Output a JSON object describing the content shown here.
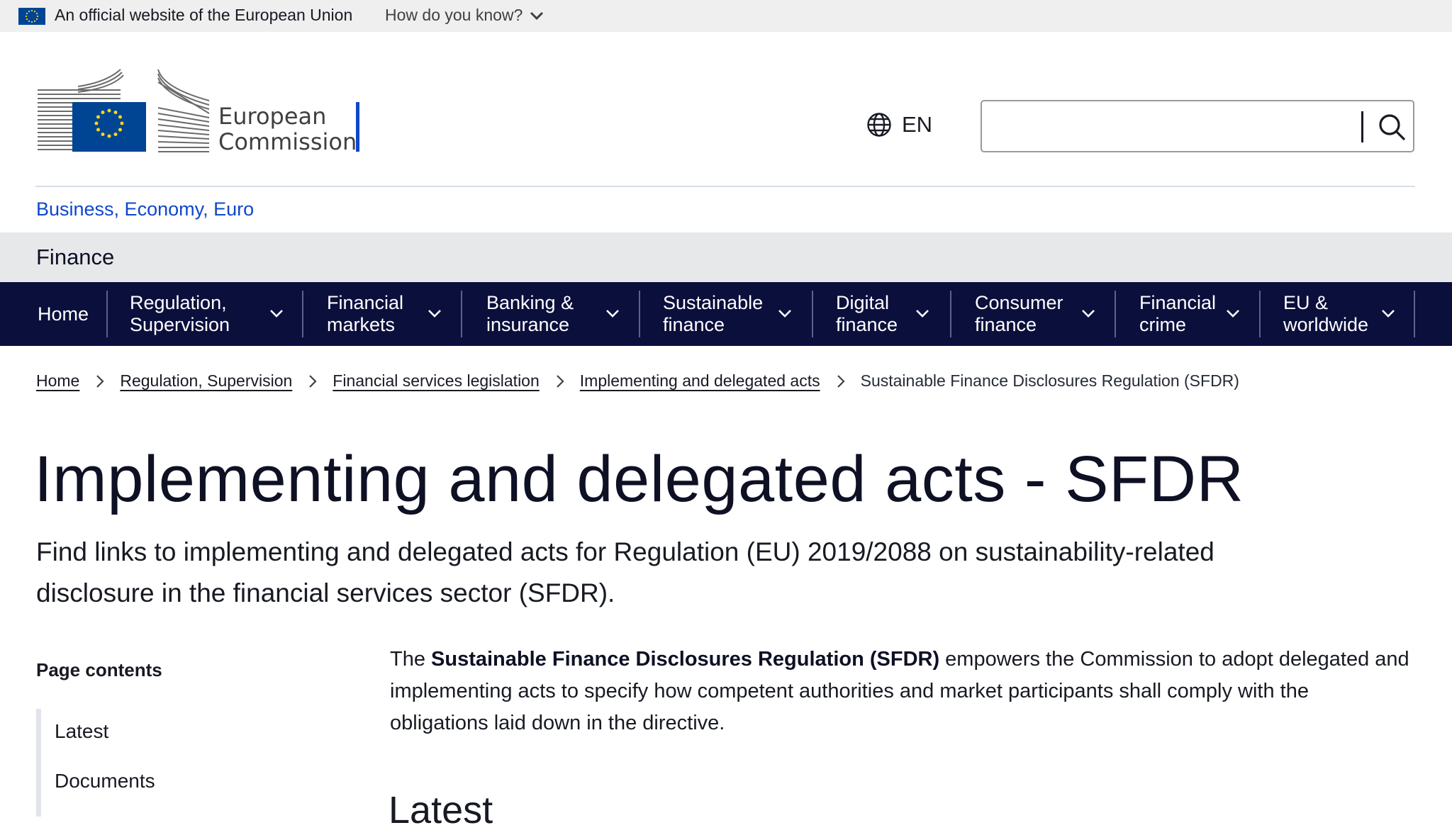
{
  "eu_bar": {
    "official_text": "An official website of the European Union",
    "how_label": "How do you know?"
  },
  "logo": {
    "line1": "European",
    "line2": "Commission"
  },
  "language": {
    "code": "EN"
  },
  "search": {
    "placeholder": "",
    "value": ""
  },
  "site_name": "Business, Economy, Euro",
  "section_title": "Finance",
  "nav": {
    "home": "Home",
    "items": [
      {
        "line1": "Regulation,",
        "line2": "Supervision"
      },
      {
        "line1": "Financial",
        "line2": "markets"
      },
      {
        "line1": "Banking &",
        "line2": "insurance"
      },
      {
        "line1": "Sustainable",
        "line2": "finance"
      },
      {
        "line1": "Digital",
        "line2": "finance"
      },
      {
        "line1": "Consumer",
        "line2": "finance"
      },
      {
        "line1": "Financial",
        "line2": "crime"
      },
      {
        "line1": "EU &",
        "line2": "worldwide"
      }
    ]
  },
  "breadcrumb": {
    "items": [
      "Home",
      "Regulation, Supervision",
      "Financial services legislation",
      "Implementing and delegated acts"
    ],
    "current": "Sustainable Finance Disclosures Regulation (SFDR)"
  },
  "page": {
    "title": "Implementing and delegated acts - SFDR",
    "intro": "Find links to implementing and delegated acts for Regulation (EU) 2019/2088 on sustainability-related disclosure in the financial services sector (SFDR)."
  },
  "toc": {
    "title": "Page contents",
    "items": [
      "Latest",
      "Documents"
    ]
  },
  "body": {
    "prefix": "The ",
    "bold": "Sustainable Finance Disclosures Regulation (SFDR)",
    "suffix": " empowers the Commission to adopt delegated and implementing acts to specify how competent authorities and market participants shall comply with the obligations laid down in the directive."
  },
  "latest_heading": "Latest",
  "colors": {
    "eu_blue": "#004494",
    "eu_yellow": "#ffd617",
    "nav_bg": "#0b0f3c",
    "link_blue": "#0e47cb",
    "band_grey": "#e6e8ea"
  },
  "icons": [
    "eu-flag-icon",
    "chevron-down-icon",
    "globe-icon",
    "search-icon",
    "chevron-right-icon"
  ]
}
